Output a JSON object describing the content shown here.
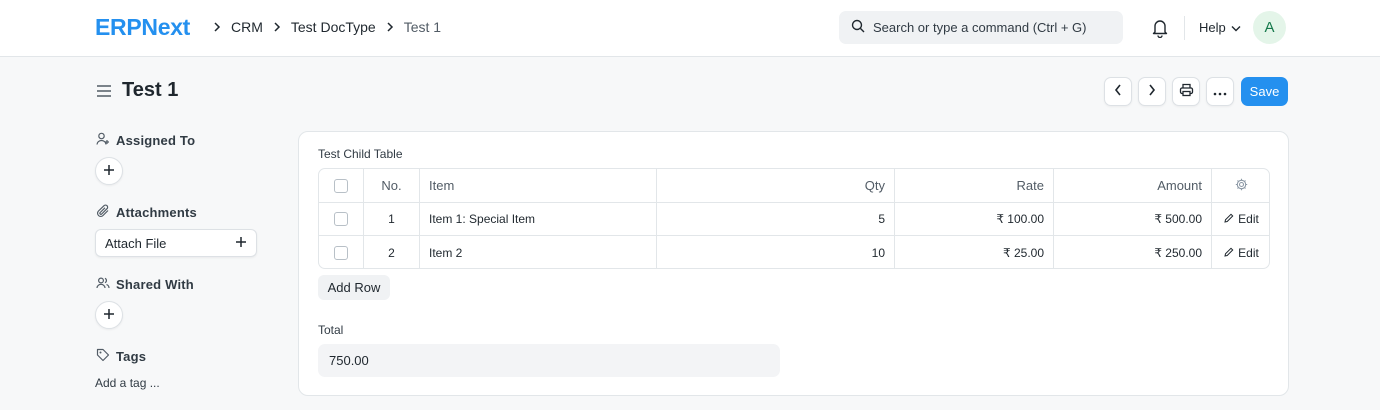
{
  "navbar": {
    "logo": "ERPNext",
    "breadcrumbs": [
      "CRM",
      "Test DocType",
      "Test 1"
    ],
    "search_placeholder": "Search or type a command (Ctrl + G)",
    "help_label": "Help",
    "avatar_initial": "A"
  },
  "page": {
    "title": "Test 1",
    "save_label": "Save"
  },
  "sidebar": {
    "assigned_to": "Assigned To",
    "attachments": "Attachments",
    "attach_file": "Attach File",
    "shared_with": "Shared With",
    "tags": "Tags",
    "add_tag": "Add a tag ..."
  },
  "form": {
    "table_label": "Test Child Table",
    "columns": [
      "No.",
      "Item",
      "Qty",
      "Rate",
      "Amount"
    ],
    "rows": [
      {
        "no": "1",
        "item": "Item 1: Special Item",
        "qty": "5",
        "rate": "₹ 100.00",
        "amount": "₹ 500.00",
        "edit": "Edit"
      },
      {
        "no": "2",
        "item": "Item 2",
        "qty": "10",
        "rate": "₹ 25.00",
        "amount": "₹ 250.00",
        "edit": "Edit"
      }
    ],
    "add_row_label": "Add Row",
    "total_label": "Total",
    "total_value": "750.00"
  },
  "colors": {
    "accent": "#2490ef",
    "avatar_bg": "#e4f5e9",
    "avatar_fg": "#16794c"
  }
}
